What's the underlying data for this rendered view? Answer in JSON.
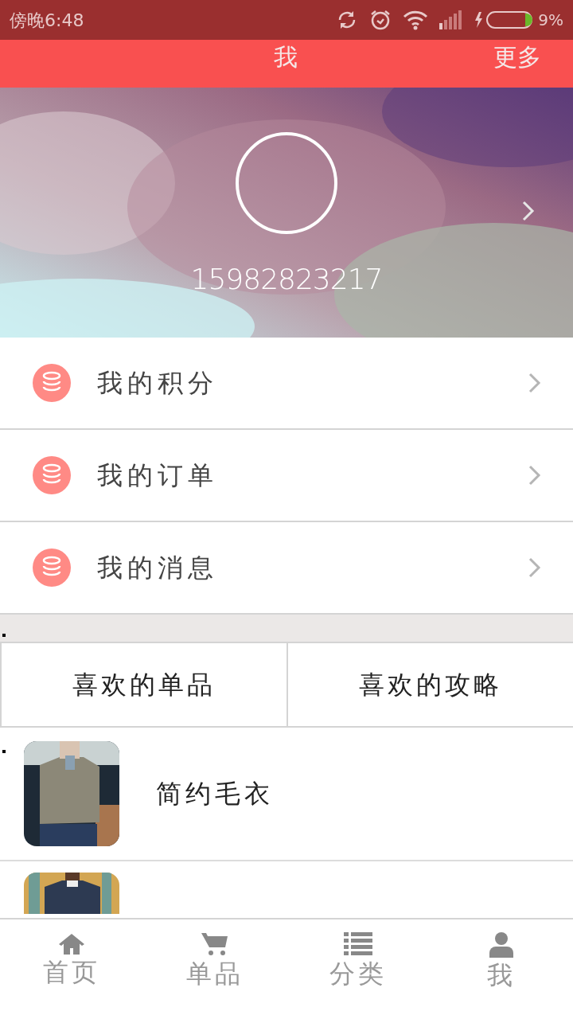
{
  "status_bar": {
    "time": "傍晚6:48",
    "battery_text": "9%"
  },
  "header": {
    "title": "我",
    "action": "更多"
  },
  "profile": {
    "phone": "15982823217"
  },
  "menu": [
    {
      "label": "我的积分"
    },
    {
      "label": "我的订单"
    },
    {
      "label": "我的消息"
    }
  ],
  "favorite_tabs": [
    {
      "label": "喜欢的单品"
    },
    {
      "label": "喜欢的攻略"
    }
  ],
  "favorites": [
    {
      "title": "简约毛衣",
      "kind": "picture"
    },
    {
      "kind": "picture"
    }
  ],
  "tab_bar": [
    {
      "label": "首页",
      "kind": "home"
    },
    {
      "label": "单品",
      "kind": "cart"
    },
    {
      "label": "分类",
      "kind": "list"
    },
    {
      "label": "我",
      "kind": "user"
    }
  ]
}
